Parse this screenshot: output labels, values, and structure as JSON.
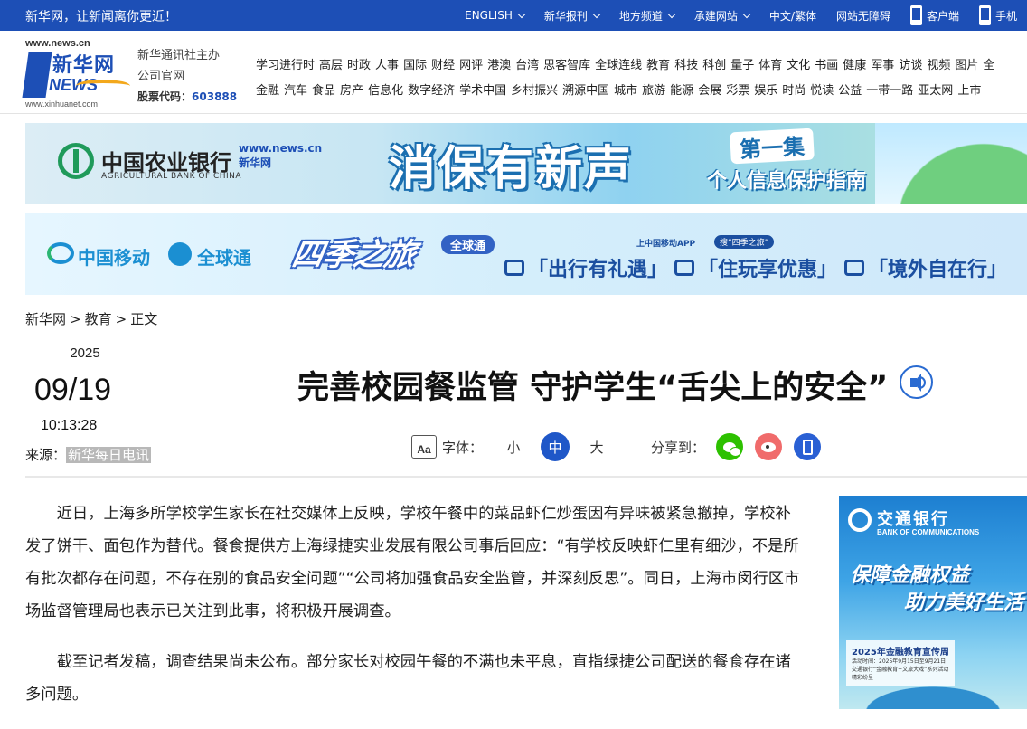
{
  "topbar": {
    "slogan": "新华网，让新闻离你更近！",
    "nav": [
      {
        "label": "ENGLISH",
        "dropdown": true
      },
      {
        "label": "新华报刊",
        "dropdown": true
      },
      {
        "label": "地方频道",
        "dropdown": true
      },
      {
        "label": "承建网站",
        "dropdown": true
      },
      {
        "label": "中文/繁体",
        "dropdown": false
      },
      {
        "label": "网站无障碍",
        "dropdown": false
      },
      {
        "label": "客户端",
        "dropdown": false,
        "icon": "phone-app-icon"
      },
      {
        "label": "手机",
        "dropdown": false,
        "icon": "mobile-icon"
      }
    ]
  },
  "header": {
    "logo": {
      "url": "www.news.cn",
      "name": "新华网",
      "news": "NEWS",
      "url2": "www.xinhuanet.com"
    },
    "org_line1": "新华通讯社主办",
    "org_line2": "公司官网",
    "stock_label": "股票代码：",
    "stock_code": "603888",
    "channels_row1": [
      "学习进行时",
      "高层",
      "时政",
      "人事",
      "国际",
      "财经",
      "网评",
      "港澳",
      "台湾",
      "思客智库",
      "全球连线",
      "教育",
      "科技",
      "科创",
      "量子",
      "体育",
      "文化",
      "书画",
      "健康",
      "军事",
      "访谈",
      "视频",
      "图片",
      "全"
    ],
    "channels_row2": [
      "金融",
      "汽车",
      "食品",
      "房产",
      "信息化",
      "数字经济",
      "学术中国",
      "乡村振兴",
      "溯源中国",
      "城市",
      "旅游",
      "能源",
      "会展",
      "彩票",
      "娱乐",
      "时尚",
      "悦读",
      "公益",
      "一带一路",
      "亚太网",
      "上市"
    ]
  },
  "banner1": {
    "bank_cn": "中国农业银行",
    "bank_en": "AGRICULTURAL BANK OF CHINA",
    "mini_logo_line1": "www.news.cn",
    "mini_logo_line2": "新华网",
    "headline": "消保有新声",
    "episode": "第一集",
    "guide": "个人信息保护指南"
  },
  "banner2": {
    "cm": "中国移动",
    "gt": "全球通",
    "season": "四季之旅",
    "tag": "全球通",
    "app_tip": "上中国移动APP",
    "search": "搜“四季之旅”",
    "slogans": [
      "「出行有礼遇」",
      "「住玩享优惠」",
      "「境外自在行」"
    ]
  },
  "breadcrumb": {
    "home": "新华网",
    "section": "教育",
    "current": "正文",
    "sep": ">"
  },
  "article": {
    "year": "2025",
    "month_day": "09/19",
    "time": "10:13:28",
    "source_label": "来源：",
    "source": "新华每日电讯",
    "title": "完善校园餐监管 守护学生“舌尖上的安全”",
    "font_icon": "Aa",
    "font_label": "字体：",
    "font_sizes": [
      "小",
      "中",
      "大"
    ],
    "font_selected": "中",
    "share_label": "分享到：",
    "paragraphs": [
      "近日，上海多所学校学生家长在社交媒体上反映，学校午餐中的菜品虾仁炒蛋因有异味被紧急撤掉，学校补发了饼干、面包作为替代。餐食提供方上海绿捷实业发展有限公司事后回应：“有学校反映虾仁里有细沙，不是所有批次都存在问题，不存在别的食品安全问题”“公司将加强食品安全监管，并深刻反思”。同日，上海市闵行区市场监督管理局也表示已关注到此事，将积极开展调查。",
      "截至记者发稿，调查结果尚未公布。部分家长对校园午餐的不满也未平息，直指绿捷公司配送的餐食存在诸多问题。"
    ]
  },
  "side_ad": {
    "bank_cn": "交通银行",
    "bank_en": "BANK OF COMMUNICATIONS",
    "slogan1": "保障金融权益",
    "slogan2": "助力美好生活",
    "card_title": "2025年金融教育宣传周",
    "card_line1": "活动时间：2025年9月15日至9月21日",
    "card_line2": "交通银行“金融教育+文旅大戏”系列活动精彩纷呈"
  },
  "colors": {
    "topbar": "#1d4fb6",
    "accent": "#1f57c8",
    "wechat": "#2dc100",
    "weibo": "#f06b6b",
    "mobile": "#2a60d4"
  }
}
